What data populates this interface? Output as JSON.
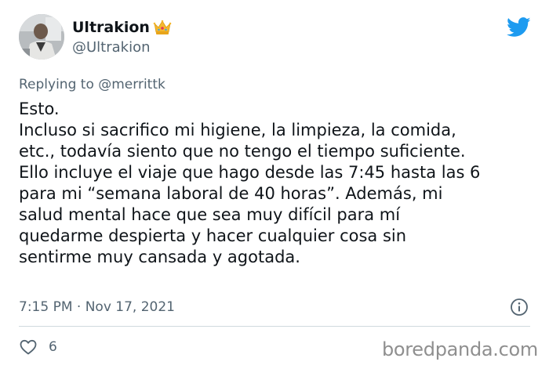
{
  "author": {
    "display_name": "Ultrakion",
    "handle": "@Ultrakion",
    "badge_icon": "crown-icon",
    "avatar_icon": "profile-photo"
  },
  "platform_icon": "twitter-bird-icon",
  "reply": {
    "prefix": "Replying to",
    "to": "@merrittk"
  },
  "tweet": {
    "lines": [
      "Esto.",
      "Incluso si sacrifico mi higiene, la limpieza, la comida,",
      "etc., todavía siento que no tengo el tiempo suficiente.",
      "Ello incluye el viaje que hago desde las 7:45 hasta las 6",
      "para mi “semana laboral de 40 horas”. Además, mi",
      "salud mental hace que sea muy difícil para mí",
      "quedarme despierta y hacer cualquier cosa sin",
      "sentirme muy cansada y agotada."
    ]
  },
  "meta": {
    "timestamp": "7:15 PM · Nov 17, 2021"
  },
  "actions": {
    "likes": "6"
  },
  "watermark": "boredpanda.com",
  "colors": {
    "twitter_blue": "#1d9bf0",
    "secondary_text": "#536471",
    "primary_text": "#0f1419",
    "crown_gold": "#f5b82e",
    "divider": "#cfd9de",
    "watermark_gray": "#8f8f8f"
  }
}
